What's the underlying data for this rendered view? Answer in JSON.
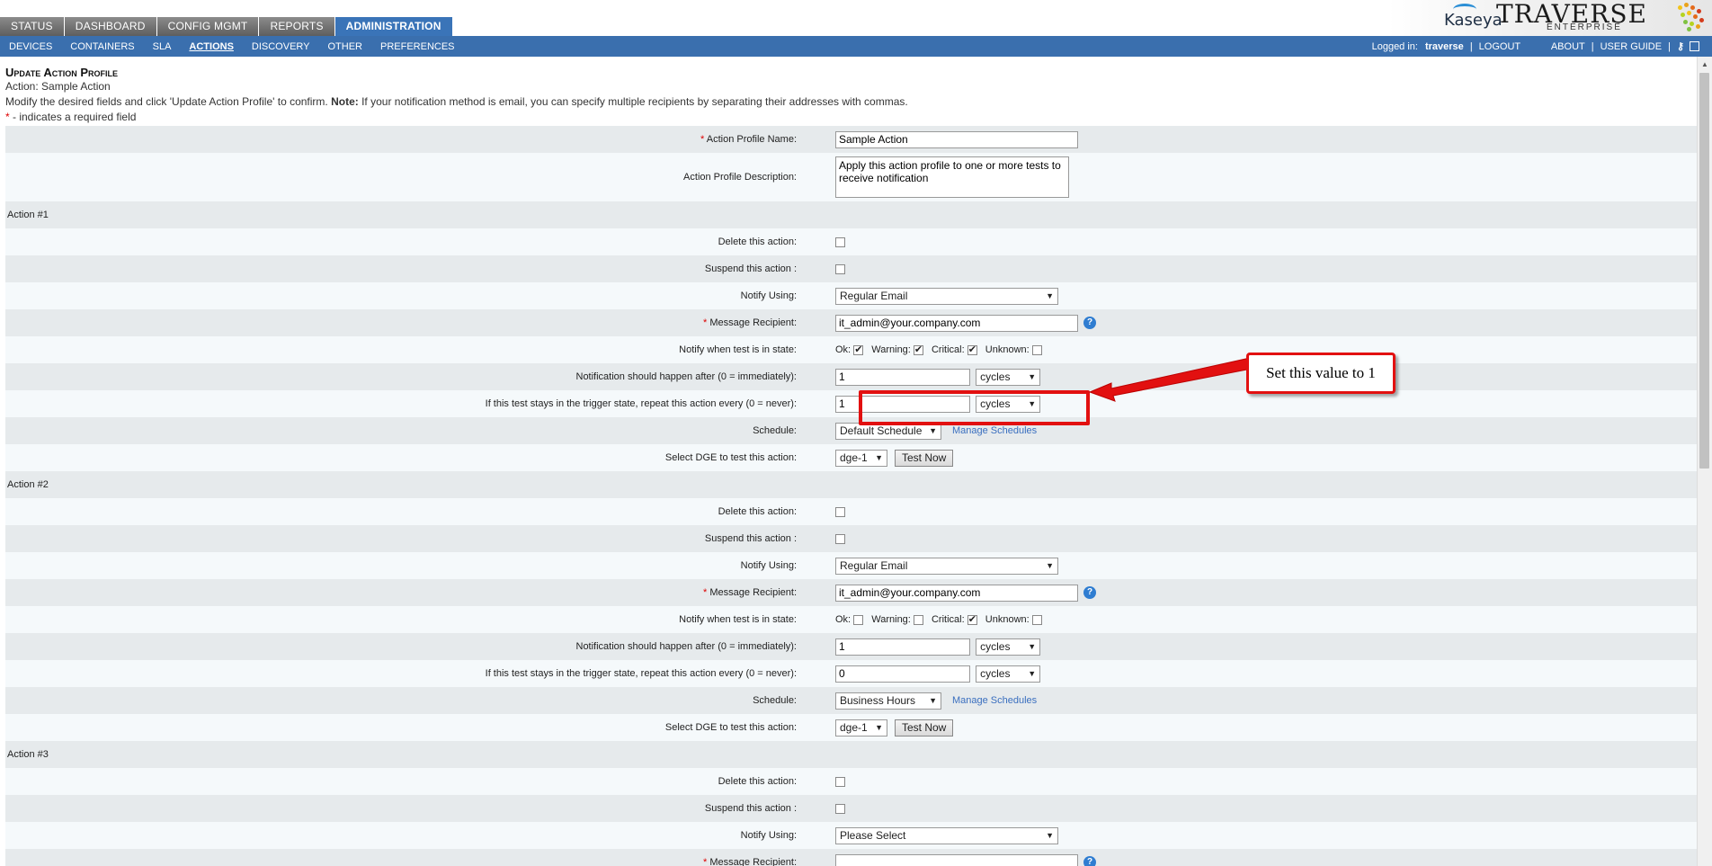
{
  "tabs": [
    {
      "label": "STATUS"
    },
    {
      "label": "DASHBOARD"
    },
    {
      "label": "CONFIG MGMT"
    },
    {
      "label": "REPORTS"
    },
    {
      "label": "ADMINISTRATION"
    }
  ],
  "brand": {
    "kaseya": "Kaseya",
    "traverse": "TRAVERSE",
    "enterprise": "ENTERPRISE"
  },
  "subnav": {
    "items": [
      {
        "label": "DEVICES"
      },
      {
        "label": "CONTAINERS"
      },
      {
        "label": "SLA"
      },
      {
        "label": "ACTIONS"
      },
      {
        "label": "DISCOVERY"
      },
      {
        "label": "OTHER"
      },
      {
        "label": "PREFERENCES"
      }
    ],
    "logged_in_label": "Logged in:",
    "user": "traverse",
    "logout": "LOGOUT",
    "about": "ABOUT",
    "user_guide": "USER GUIDE",
    "sep": "|"
  },
  "page": {
    "title": "Update Action Profile",
    "subtitle": "Action: Sample Action",
    "instructions_pre": "Modify the desired fields and click 'Update Action Profile' to confirm. ",
    "note_label": "Note:",
    "instructions_post": " If your notification method is email, you can specify multiple recipients by separating their addresses with commas.",
    "required_star": "*",
    "required_note": " - indicates a required field"
  },
  "profile": {
    "name_label": "Action Profile Name:",
    "name_value": "Sample Action",
    "desc_label": "Action Profile Description:",
    "desc_value": "Apply this action profile to one or more tests to receive notification"
  },
  "labels": {
    "delete": "Delete this action:",
    "suspend": "Suspend this action :",
    "notify_using": "Notify Using:",
    "recipient": "Message Recipient:",
    "notify_state": "Notify when test is in state:",
    "ok": "Ok:",
    "warning": "Warning:",
    "critical": "Critical:",
    "unknown": "Unknown:",
    "notify_after": "Notification should happen after (0 = immediately):",
    "repeat": "If this test stays in the trigger state, repeat this action every (0 = never):",
    "schedule": "Schedule:",
    "manage": "Manage Schedules",
    "dge": "Select DGE to test this action:",
    "test_now": "Test Now",
    "help": "?",
    "star": "*"
  },
  "actions": [
    {
      "title": "Action #1",
      "notify_using": "Regular Email",
      "recipient": "it_admin@your.company.com",
      "after": "1",
      "after_unit": "cycles",
      "repeat": "1",
      "repeat_unit": "cycles",
      "schedule": "Default Schedule",
      "dge": "dge-1"
    },
    {
      "title": "Action #2",
      "notify_using": "Regular Email",
      "recipient": "it_admin@your.company.com",
      "after": "1",
      "after_unit": "cycles",
      "repeat": "0",
      "repeat_unit": "cycles",
      "schedule": "Business Hours",
      "dge": "dge-1"
    },
    {
      "title": "Action #3",
      "notify_using": "Please Select",
      "recipient": ""
    }
  ],
  "annotation": {
    "text": "Set this value to 1"
  },
  "colors": {
    "accent": "#3a74b8",
    "annotation": "#e21010"
  }
}
